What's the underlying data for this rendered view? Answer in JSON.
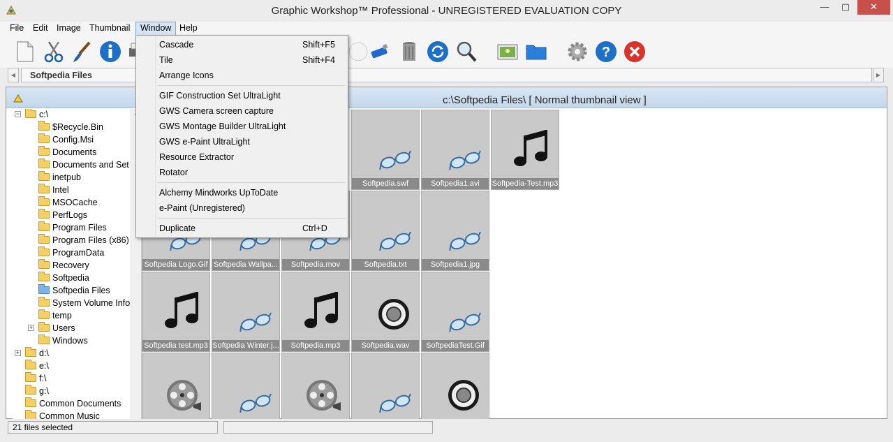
{
  "window": {
    "title": "Graphic Workshop™ Professional - UNREGISTERED EVALUATION COPY",
    "minimize": "—",
    "maximize": "▢",
    "close": "✕"
  },
  "menubar": {
    "items": [
      "File",
      "Edit",
      "Image",
      "Thumbnail",
      "Window",
      "Help"
    ],
    "active": "Window"
  },
  "toolbar": {
    "icons": [
      "new-document-icon",
      "cut-icon",
      "paintbrush-icon",
      "info-icon",
      "printer-icon",
      "disc-icon",
      "usb-drive-icon",
      "trash-can-icon",
      "refresh-icon",
      "magnifier-icon",
      "image-icon",
      "folder-icon",
      "settings-gear-icon",
      "help-icon",
      "exit-icon"
    ]
  },
  "address": {
    "tab_label": "Softpedia Files"
  },
  "view": {
    "path_title": "c:\\Softpedia Files\\ [ Normal thumbnail view ]"
  },
  "tree": {
    "nodes": [
      {
        "label": "c:\\",
        "expander": "-"
      },
      {
        "label": "$Recycle.Bin"
      },
      {
        "label": "Config.Msi"
      },
      {
        "label": "Documents"
      },
      {
        "label": "Documents and Set"
      },
      {
        "label": "inetpub"
      },
      {
        "label": "Intel"
      },
      {
        "label": "MSOCache"
      },
      {
        "label": "PerfLogs"
      },
      {
        "label": "Program Files"
      },
      {
        "label": "Program Files (x86)"
      },
      {
        "label": "ProgramData"
      },
      {
        "label": "Recovery"
      },
      {
        "label": "Softpedia"
      },
      {
        "label": "Softpedia Files",
        "selected": true
      },
      {
        "label": "System Volume Info"
      },
      {
        "label": "temp"
      },
      {
        "label": "Users",
        "expander": "+"
      },
      {
        "label": "Windows"
      },
      {
        "label": "d:\\",
        "expander": "+"
      },
      {
        "label": "e:\\"
      },
      {
        "label": "f:\\"
      },
      {
        "label": "g:\\"
      },
      {
        "label": "Common Documents"
      },
      {
        "label": "Common Music"
      }
    ]
  },
  "thumbnails": [
    {
      "caption": "Softpedia.swf",
      "icon": "glasses-icon"
    },
    {
      "caption": "Softpedia1.avi",
      "icon": "glasses-icon"
    },
    {
      "caption": "Softpedia-Test.mp3",
      "icon": "music-note-icon"
    },
    {
      "caption": "Softpedia Logo.Gif",
      "icon": "glasses-icon"
    },
    {
      "caption": "Softpedia Wallpa...",
      "icon": "glasses-icon"
    },
    {
      "caption": "Softpedia.mov",
      "icon": "glasses-icon"
    },
    {
      "caption": "Softpedia.txt",
      "icon": "glasses-icon"
    },
    {
      "caption": "Softpedia1.jpg",
      "icon": "glasses-icon"
    },
    {
      "caption": "Softpedia test.mp3",
      "icon": "music-note-icon"
    },
    {
      "caption": "Softpedia Winter.j...",
      "icon": "glasses-icon"
    },
    {
      "caption": "Softpedia.mp3",
      "icon": "music-note-icon"
    },
    {
      "caption": "Softpedia.wav",
      "icon": "speaker-icon"
    },
    {
      "caption": "SoftpediaTest.Gif",
      "icon": "glasses-icon"
    },
    {
      "caption": "",
      "icon": "film-reel-icon"
    },
    {
      "caption": "",
      "icon": "glasses-icon"
    },
    {
      "caption": "",
      "icon": "film-reel-icon"
    },
    {
      "caption": "",
      "icon": "glasses-icon"
    },
    {
      "caption": "",
      "icon": "speaker-icon"
    }
  ],
  "window_menu": {
    "items": [
      {
        "label": "Cascade",
        "shortcut": "Shift+F5"
      },
      {
        "label": "Tile",
        "shortcut": "Shift+F4"
      },
      {
        "label": "Arrange Icons",
        "shortcut": ""
      },
      {
        "separator": true
      },
      {
        "label": "GIF Construction Set UltraLight",
        "shortcut": ""
      },
      {
        "label": "GWS Camera screen capture",
        "shortcut": ""
      },
      {
        "label": "GWS Montage Builder UltraLight",
        "shortcut": ""
      },
      {
        "label": "GWS e-Paint UltraLight",
        "shortcut": ""
      },
      {
        "label": "Resource Extractor",
        "shortcut": ""
      },
      {
        "label": "Rotator",
        "shortcut": ""
      },
      {
        "separator": true
      },
      {
        "label": "Alchemy Mindworks UpToDate",
        "shortcut": ""
      },
      {
        "label": "e-Paint (Unregistered)",
        "shortcut": ""
      },
      {
        "separator": true
      },
      {
        "label": "Duplicate",
        "shortcut": "Ctrl+D"
      }
    ]
  },
  "status": {
    "selection": "21 files selected"
  },
  "colors": {
    "accent_blue": "#1e6fc8",
    "close_red": "#c7504a",
    "menu_highlight": "#d5e5f6"
  }
}
